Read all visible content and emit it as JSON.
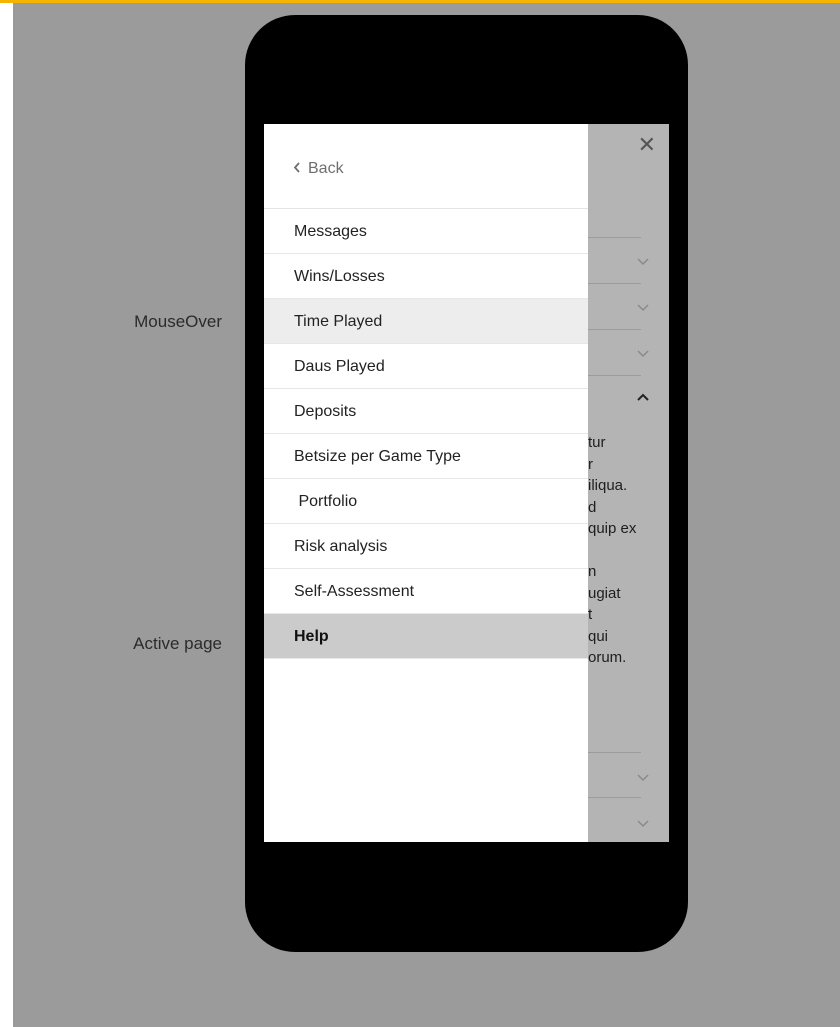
{
  "annotations": {
    "mouseover_label": "MouseOver",
    "active_label": "Active page"
  },
  "screen": {
    "close_glyph": "✕",
    "background_text": "tur\nr\niliqua.\nd\nquip ex\n\nn\nugiat\nt\nqui\norum."
  },
  "drawer": {
    "back_label": "Back",
    "items": [
      {
        "label": "Messages",
        "state": "normal"
      },
      {
        "label": "Wins/Losses",
        "state": "normal"
      },
      {
        "label": "Time Played",
        "state": "hover"
      },
      {
        "label": "Daus Played",
        "state": "normal"
      },
      {
        "label": "Deposits",
        "state": "normal"
      },
      {
        "label": "Betsize per Game Type",
        "state": "normal"
      },
      {
        "label": " Portfolio",
        "state": "normal"
      },
      {
        "label": "Risk analysis",
        "state": "normal"
      },
      {
        "label": "Self-Assessment",
        "state": "normal"
      },
      {
        "label": "Help",
        "state": "active"
      }
    ]
  },
  "colors": {
    "accent_bar": "#f5b400",
    "page_bg": "#9b9b9b",
    "hover_bg": "#ededed",
    "active_bg": "#cbcbcb"
  },
  "icons": {
    "back": "chevron-left-icon",
    "close": "close-icon",
    "accordion_collapsed": "chevron-down-icon",
    "accordion_expanded": "chevron-up-icon"
  }
}
